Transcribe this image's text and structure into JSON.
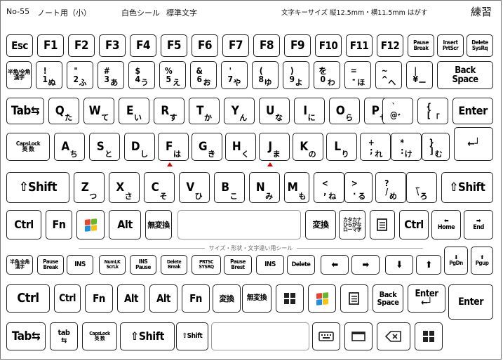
{
  "header": {
    "product_no": "No-55",
    "product_desc": "ノート用（小）",
    "sticker_desc": "白色シール",
    "font_desc": "標準文字",
    "size_info": "文字キーサイズ 縦12.5mm・横11.5mm はがす",
    "practice": "練習"
  },
  "section_label": "サイズ・形状・文字違い用シール",
  "colors": {
    "accent_mark": "#dd0000",
    "border": "#222222"
  },
  "keys": [
    {
      "id": "esc",
      "label": "Esc"
    },
    {
      "id": "f1",
      "label": "F1"
    },
    {
      "id": "f2",
      "label": "F2"
    },
    {
      "id": "f3",
      "label": "F3"
    },
    {
      "id": "f4",
      "label": "F4"
    },
    {
      "id": "f5",
      "label": "F5"
    },
    {
      "id": "f6",
      "label": "F6"
    },
    {
      "id": "f7",
      "label": "F7"
    },
    {
      "id": "f8",
      "label": "F8"
    },
    {
      "id": "f9",
      "label": "F9"
    },
    {
      "id": "f10",
      "label": "F10"
    },
    {
      "id": "f11",
      "label": "F11"
    },
    {
      "id": "f12",
      "label": "F12"
    },
    {
      "id": "pause-break",
      "label": "Pause\nBreak"
    },
    {
      "id": "insert-prtscr",
      "label": "Insert\nPrtScr"
    },
    {
      "id": "delete-sysrq",
      "label": "Delete\nSysRq"
    },
    {
      "id": "hankaku",
      "label": "半角/全角\n漢字"
    },
    {
      "id": "k1",
      "label": "!\n1",
      "kana": "ぬ"
    },
    {
      "id": "k2",
      "label": "\"\n2",
      "kana": "ふ"
    },
    {
      "id": "k3",
      "label": "#\n3",
      "kana": "あ"
    },
    {
      "id": "k4",
      "label": "$\n4",
      "kana": "う"
    },
    {
      "id": "k5",
      "label": "%\n5",
      "kana": "え"
    },
    {
      "id": "k6",
      "label": "&\n6",
      "kana": "お"
    },
    {
      "id": "k7",
      "label": "'\n7",
      "kana": "や"
    },
    {
      "id": "k8",
      "label": "(\n8",
      "kana": "ゆ"
    },
    {
      "id": "k9",
      "label": ")\n9",
      "kana": "よ"
    },
    {
      "id": "k0",
      "label": "を\n0",
      "kana": "わ"
    },
    {
      "id": "kminus",
      "label": "=\n-",
      "kana": "ほ"
    },
    {
      "id": "kcaret",
      "label": "~\n^",
      "kana": "へ"
    },
    {
      "id": "kyen",
      "label": "|\n¥",
      "kana": "ー"
    },
    {
      "id": "backspace",
      "label": "Back\nSpace"
    },
    {
      "id": "tab",
      "label": "Tab⇆"
    },
    {
      "id": "q",
      "label": "Q",
      "kana": "た"
    },
    {
      "id": "w",
      "label": "W",
      "kana": "て"
    },
    {
      "id": "e",
      "label": "E",
      "kana": "い"
    },
    {
      "id": "r",
      "label": "R",
      "kana": "す"
    },
    {
      "id": "t",
      "label": "T",
      "kana": "か"
    },
    {
      "id": "y",
      "label": "Y",
      "kana": "ん"
    },
    {
      "id": "u",
      "label": "U",
      "kana": "な"
    },
    {
      "id": "i",
      "label": "I",
      "kana": "に"
    },
    {
      "id": "o",
      "label": "O",
      "kana": "ら"
    },
    {
      "id": "p",
      "label": "P",
      "kana": "せ"
    },
    {
      "id": "at",
      "label": "`\n@",
      "kana": "゛"
    },
    {
      "id": "lbracket",
      "label": "{\n[",
      "kana": "「"
    },
    {
      "id": "enter",
      "label": "Enter"
    },
    {
      "id": "capslock",
      "label": "CapsLock\n英 数"
    },
    {
      "id": "a",
      "label": "A",
      "kana": "ち"
    },
    {
      "id": "s",
      "label": "S",
      "kana": "と"
    },
    {
      "id": "d",
      "label": "D",
      "kana": "し"
    },
    {
      "id": "f",
      "label": "F",
      "kana": "は"
    },
    {
      "id": "g",
      "label": "G",
      "kana": "き"
    },
    {
      "id": "h",
      "label": "H",
      "kana": "く"
    },
    {
      "id": "j",
      "label": "J",
      "kana": "ま"
    },
    {
      "id": "k",
      "label": "K",
      "kana": "の"
    },
    {
      "id": "l",
      "label": "L",
      "kana": "り"
    },
    {
      "id": "semicolon",
      "label": "+\n;",
      "kana": "れ"
    },
    {
      "id": "colon",
      "label": "*\n:",
      "kana": "け"
    },
    {
      "id": "rbracket",
      "label": "}\n]",
      "kana": "む"
    },
    {
      "id": "enter-lower",
      "label": "←┘"
    },
    {
      "id": "lshift",
      "label": "⇧Shift"
    },
    {
      "id": "z",
      "label": "Z",
      "kana": "つ"
    },
    {
      "id": "x",
      "label": "X",
      "kana": "さ"
    },
    {
      "id": "c",
      "label": "C",
      "kana": "そ"
    },
    {
      "id": "v",
      "label": "V",
      "kana": "ひ"
    },
    {
      "id": "b",
      "label": "B",
      "kana": "こ"
    },
    {
      "id": "n",
      "label": "N",
      "kana": "み"
    },
    {
      "id": "m",
      "label": "M",
      "kana": "も"
    },
    {
      "id": "comma",
      "label": "<\n,",
      "kana": "ね"
    },
    {
      "id": "period",
      "label": ">\n.",
      "kana": "る"
    },
    {
      "id": "slash",
      "label": "?\n/",
      "kana": "め"
    },
    {
      "id": "backslash",
      "label": "_\n\\",
      "kana": "ろ"
    },
    {
      "id": "rshift",
      "label": "⇧Shift"
    },
    {
      "id": "lctrl",
      "label": "Ctrl"
    },
    {
      "id": "fn",
      "label": "Fn"
    },
    {
      "id": "windows",
      "label": ""
    },
    {
      "id": "alt",
      "label": "Alt"
    },
    {
      "id": "muhenkan",
      "label": "無変換"
    },
    {
      "id": "space",
      "label": ""
    },
    {
      "id": "henkan",
      "label": "変換"
    },
    {
      "id": "katakana",
      "label": "カタカナ\nひらがな\nローマ字"
    },
    {
      "id": "menu",
      "label": ""
    },
    {
      "id": "rctrl",
      "label": "Ctrl"
    },
    {
      "id": "home",
      "label": "⬅\nHome"
    },
    {
      "id": "end",
      "label": "➡\nEnd"
    },
    {
      "id": "s-hankaku",
      "label": "半角/全角\n漢字"
    },
    {
      "id": "s-pause",
      "label": "Pause\nBreak"
    },
    {
      "id": "s-ins",
      "label": "INS"
    },
    {
      "id": "s-numlk",
      "label": "NumLK\nScrLk"
    },
    {
      "id": "s-ins-pause",
      "label": "INS\nPause"
    },
    {
      "id": "s-delete-break",
      "label": "Delete\nBreak"
    },
    {
      "id": "s-prtsc",
      "label": "PRTSC\nSYSRQ"
    },
    {
      "id": "s-pause-brest",
      "label": "Pause\nBrest"
    },
    {
      "id": "s-ins2",
      "label": "INS"
    },
    {
      "id": "s-delete",
      "label": "Delete"
    },
    {
      "id": "s-left",
      "label": "⬅"
    },
    {
      "id": "s-right",
      "label": "➡"
    },
    {
      "id": "s-down",
      "label": "⬇"
    },
    {
      "id": "s-up",
      "label": "⬆"
    },
    {
      "id": "s-pgdn",
      "label": "⬇\nPgDn"
    },
    {
      "id": "s-pgup",
      "label": "⬆\nPgup"
    },
    {
      "id": "s-ctrl-big",
      "label": "Ctrl"
    },
    {
      "id": "s-ctrl",
      "label": "Ctrl"
    },
    {
      "id": "s-fn",
      "label": "Fn"
    },
    {
      "id": "s-alt",
      "label": "Alt"
    },
    {
      "id": "s-alt2",
      "label": "Alt"
    },
    {
      "id": "s-fn2",
      "label": "Fn"
    },
    {
      "id": "s-henkan",
      "label": "変換"
    },
    {
      "id": "s-muhenkan",
      "label": "無変換"
    },
    {
      "id": "s-win-mono",
      "label": ""
    },
    {
      "id": "s-win-color",
      "label": ""
    },
    {
      "id": "s-menu",
      "label": ""
    },
    {
      "id": "s-backspace",
      "label": "Back\nSpace"
    },
    {
      "id": "s-enter",
      "label": "Enter\n←┘"
    },
    {
      "id": "s-enter-tall",
      "label": "Enter"
    },
    {
      "id": "s-tab",
      "label": "Tab⇆"
    },
    {
      "id": "s-tab-small",
      "label": "tab\n⇆"
    },
    {
      "id": "s-capslock",
      "label": "CapsLock\n英 数"
    },
    {
      "id": "s-shift",
      "label": "⇧Shift"
    },
    {
      "id": "s-shift-small",
      "label": "⇧Shift"
    },
    {
      "id": "s-space",
      "label": ""
    },
    {
      "id": "s-keyboard",
      "label": ""
    },
    {
      "id": "s-window",
      "label": ""
    },
    {
      "id": "s-bksp-icon",
      "label": ""
    },
    {
      "id": "s-win-mono2",
      "label": ""
    }
  ]
}
